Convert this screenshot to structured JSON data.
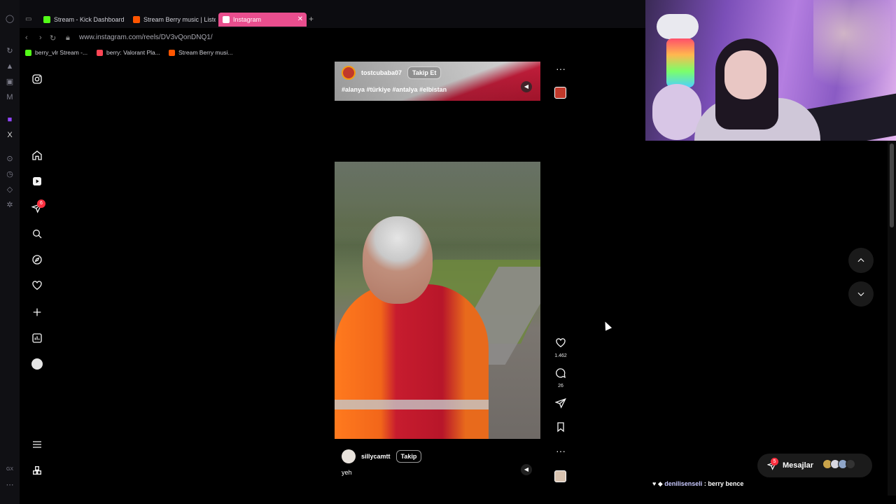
{
  "browser": {
    "tabs": [
      {
        "label": "Stream - Kick Dashboard",
        "color": "#53fc18"
      },
      {
        "label": "Stream Berry music | Liste",
        "color": "#ff5500"
      },
      {
        "label": "Instagram",
        "color": "#e1306c"
      }
    ],
    "url": "www.instagram.com/reels/DV3vQonDNQ1/",
    "bookmarks": [
      {
        "label": "berry_vlr Stream -...",
        "color": "#53fc18"
      },
      {
        "label": "berry: Valorant Pla...",
        "color": "#ff4655"
      },
      {
        "label": "Stream Berry musi...",
        "color": "#ff5500"
      }
    ]
  },
  "instagram": {
    "sidebar": {
      "notification_count": "6",
      "icons": [
        "instagram-logo-icon",
        "home-icon",
        "reels-icon",
        "messages-icon",
        "search-icon",
        "explore-icon",
        "heart-icon",
        "create-icon",
        "dashboard-icon",
        "profile-avatar",
        "menu-icon",
        "apps-icon"
      ]
    },
    "reel_top": {
      "username": "tostcubaba07",
      "follow_label": "Takip Et",
      "caption": "#alanya #türkiye #antalya #elbistan"
    },
    "reel_main": {
      "username": "sillycamtt",
      "follow_label": "Takip",
      "caption": "yeh",
      "likes": "1.462",
      "comments": "26"
    },
    "messages": {
      "label": "Mesajlar",
      "badge": "5"
    }
  },
  "stream_overlay": {
    "chat_user": "denilisenseli",
    "chat_message": ": berry bence"
  }
}
